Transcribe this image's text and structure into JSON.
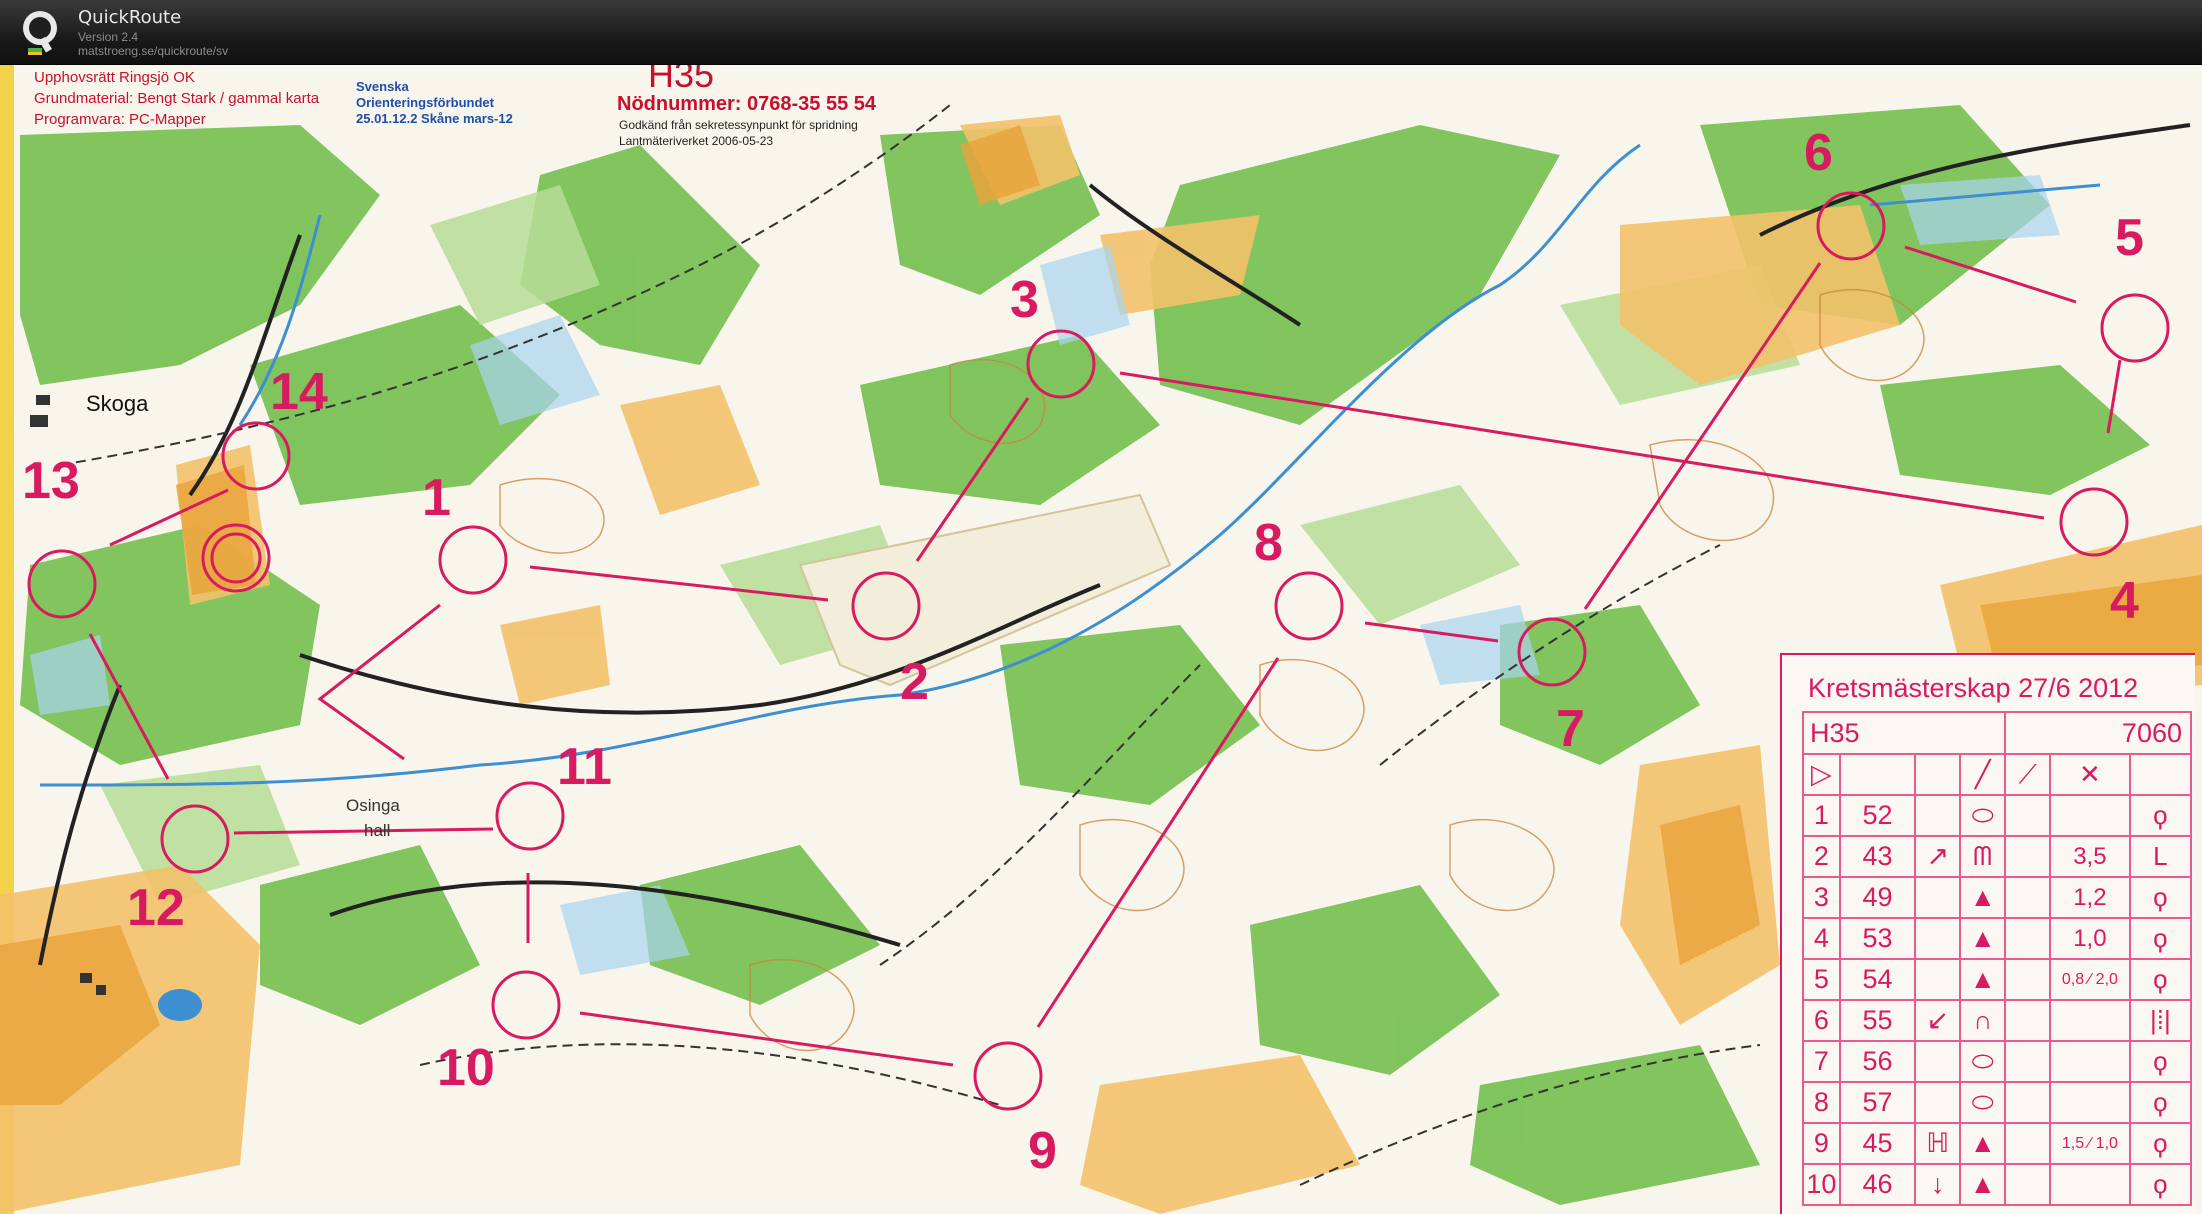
{
  "app": {
    "name": "QuickRoute",
    "version": "Version 2.4",
    "url": "matstroeng.se/quickroute/sv"
  },
  "map": {
    "copyright": "Upphovsrätt Ringsjö OK",
    "base_material": "Grundmaterial: Bengt Stark / gammal karta",
    "software": "Programvara: PC-Mapper",
    "federation_line1": "Svenska",
    "federation_line2": "Orienteringsförbundet",
    "federation_line3": "25.01.12.2 Skåne mars-12",
    "class": "H35",
    "emergency": "Nödnummer: 0768-35 55 54",
    "approval_line1": "Godkänd från sekretessynpunkt för spridning",
    "approval_line2": "Lantmäteriverket 2006-05-23",
    "place_skoga": "Skoga",
    "place_osinga": "Osinga",
    "place_hall": "hall",
    "controls": [
      "1",
      "2",
      "3",
      "4",
      "5",
      "6",
      "7",
      "8",
      "9",
      "10",
      "11",
      "12",
      "13",
      "14"
    ]
  },
  "description": {
    "title": "Kretsmästerskap 27/6 2012",
    "class": "H35",
    "length": "7060",
    "header_symbols": [
      "▷",
      "",
      "",
      "╱",
      "⟋",
      "✕",
      ""
    ],
    "rows": [
      {
        "n": "1",
        "code": "52",
        "dir": "",
        "feat": "⬭",
        "dim": "",
        "extra": "ϙ"
      },
      {
        "n": "2",
        "code": "43",
        "dir": "↗",
        "feat": "ᗰ",
        "dim": "3,5",
        "extra": "L"
      },
      {
        "n": "3",
        "code": "49",
        "dir": "",
        "feat": "▲",
        "dim": "1,2",
        "extra": "ϙ"
      },
      {
        "n": "4",
        "code": "53",
        "dir": "",
        "feat": "▲",
        "dim": "1,0",
        "extra": "ϙ"
      },
      {
        "n": "5",
        "code": "54",
        "dir": "",
        "feat": "▲",
        "dim": "0,8 ⁄ 2,0",
        "extra": "ϙ"
      },
      {
        "n": "6",
        "code": "55",
        "dir": "↙",
        "feat": "∩",
        "dim": "",
        "extra": "|⁞|"
      },
      {
        "n": "7",
        "code": "56",
        "dir": "",
        "feat": "⬭",
        "dim": "",
        "extra": "ϙ"
      },
      {
        "n": "8",
        "code": "57",
        "dir": "",
        "feat": "⬭",
        "dim": "",
        "extra": "ϙ"
      },
      {
        "n": "9",
        "code": "45",
        "dir": "ℍ",
        "feat": "▲",
        "dim": "1,5 ⁄ 1,0",
        "extra": "ϙ"
      },
      {
        "n": "10",
        "code": "46",
        "dir": "↓",
        "feat": "▲",
        "dim": "",
        "extra": "ϙ"
      }
    ]
  },
  "colors": {
    "course": "#d81b60",
    "forest_green": "#6dbb4a",
    "open_yellow": "#f2c26a",
    "water_blue": "#3d8fd1"
  }
}
